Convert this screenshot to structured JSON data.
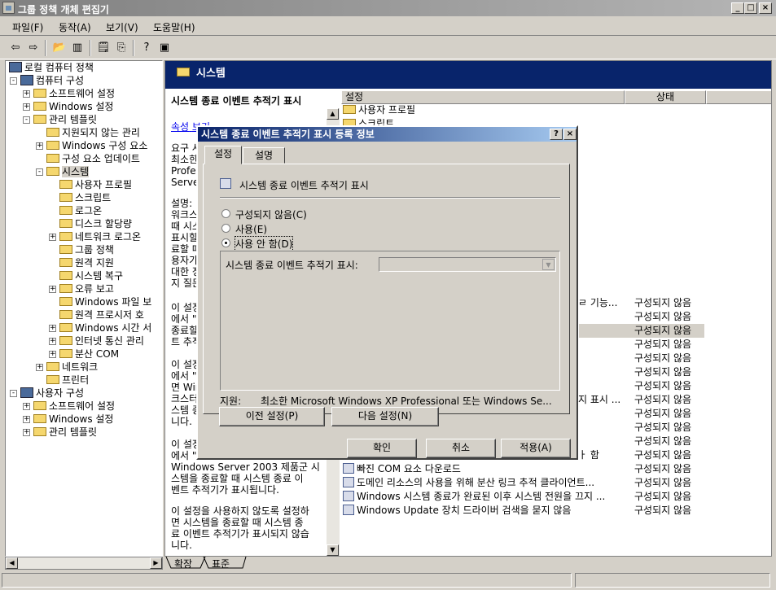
{
  "window": {
    "title": "그룹 정책 개체 편집기",
    "min": "_",
    "max": "□",
    "close": "×"
  },
  "menu": [
    "파일(F)",
    "동작(A)",
    "보기(V)",
    "도움말(H)"
  ],
  "toolbar_icons": [
    "back-arrow-icon",
    "forward-arrow-icon",
    "up-folder-icon",
    "show-tree-icon",
    "properties-icon",
    "export-icon",
    "help-icon",
    "console-icon"
  ],
  "tree": {
    "root": "로컬 컴퓨터 정책",
    "items": [
      {
        "label": "컴퓨터 구성",
        "level": 1,
        "exp": "-"
      },
      {
        "label": "소프트웨어 설정",
        "level": 2,
        "exp": "+"
      },
      {
        "label": "Windows 설정",
        "level": 2,
        "exp": "+"
      },
      {
        "label": "관리 템플릿",
        "level": 2,
        "exp": "-"
      },
      {
        "label": "지원되지 않는 관리",
        "level": 3,
        "exp": ""
      },
      {
        "label": "Windows 구성 요소",
        "level": 3,
        "exp": "+"
      },
      {
        "label": "구성 요소 업데이트",
        "level": 3,
        "exp": ""
      },
      {
        "label": "시스템",
        "level": 3,
        "exp": "-"
      },
      {
        "label": "사용자 프로필",
        "level": 4,
        "exp": ""
      },
      {
        "label": "스크립트",
        "level": 4,
        "exp": ""
      },
      {
        "label": "로그온",
        "level": 4,
        "exp": ""
      },
      {
        "label": "디스크 할당량",
        "level": 4,
        "exp": ""
      },
      {
        "label": "네트워크 로그온",
        "level": 4,
        "exp": "+"
      },
      {
        "label": "그룹 정책",
        "level": 4,
        "exp": ""
      },
      {
        "label": "원격 지원",
        "level": 4,
        "exp": ""
      },
      {
        "label": "시스템 복구",
        "level": 4,
        "exp": ""
      },
      {
        "label": "오류 보고",
        "level": 4,
        "exp": "+"
      },
      {
        "label": "Windows 파일 보",
        "level": 4,
        "exp": ""
      },
      {
        "label": "원격 프로시저 호",
        "level": 4,
        "exp": ""
      },
      {
        "label": "Windows 시간 서",
        "level": 4,
        "exp": "+"
      },
      {
        "label": "인터넷 통신 관리",
        "level": 4,
        "exp": "+"
      },
      {
        "label": "분산 COM",
        "level": 4,
        "exp": "+"
      },
      {
        "label": "네트워크",
        "level": 3,
        "exp": "+"
      },
      {
        "label": "프린터",
        "level": 3,
        "exp": ""
      },
      {
        "label": "사용자 구성",
        "level": 1,
        "exp": "-"
      },
      {
        "label": "소프트웨어 설정",
        "level": 2,
        "exp": "+"
      },
      {
        "label": "Windows 설정",
        "level": 2,
        "exp": "+"
      },
      {
        "label": "관리 템플릿",
        "level": 2,
        "exp": "+"
      }
    ]
  },
  "right": {
    "header": "시스템",
    "desc_title": "시스템 종료 이벤트 추적기 표시",
    "desc_link": "속성",
    "desc_link_after": "보기",
    "desc_blocks": [
      [
        "요구 사",
        "최소한",
        "Profes",
        "Serve"
      ],
      [
        "설명:",
        "워크스",
        "때 시스",
        "표시할",
        "료할 때",
        "용자가",
        "대한 정",
        "지 질문"
      ],
      [
        "이 설정",
        "에서 \"",
        "종료할",
        "트 추적"
      ],
      [
        "이 설정",
        "에서 \"",
        "면 Win",
        "크스터",
        "스템 종",
        "니다."
      ],
      [
        "이 설정",
        "에서 \"",
        "Windows Server 2003 제품군 시",
        "스템을 종료할 때 시스템 종료 이",
        "벤트 추적기가 표시됩니다."
      ],
      [
        "이 설정을 사용하지 않도록 설정하",
        "면 시스템을 종료할 때 시스템 종",
        "료 이벤트 추적기가 표시되지 않습",
        "니다."
      ]
    ],
    "col_setting": "설정",
    "col_status": "상태",
    "top_rows": [
      "사용자 프로필",
      "스크립트"
    ],
    "rows": [
      {
        "name": "",
        "tail": "ㄹ 기능...",
        "status": "구성되지 않음"
      },
      {
        "name": "",
        "tail": "",
        "status": "구성되지 않음"
      },
      {
        "name": "",
        "tail": "",
        "status": "구성되지 않음"
      },
      {
        "name": "",
        "tail": "",
        "status": "구성되지 않음"
      },
      {
        "name": "",
        "tail": "",
        "status": "구성되지 않음"
      },
      {
        "name": "",
        "tail": "",
        "status": "구성되지 않음"
      },
      {
        "name": "",
        "tail": "",
        "status": "구성되지 않음"
      },
      {
        "name": "",
        "tail": "지 표시 ...",
        "status": "구성되지 않음"
      },
      {
        "name": "",
        "tail": "",
        "status": "구성되지 않음"
      },
      {
        "name": "",
        "tail": "",
        "status": "구성되지 않음"
      },
      {
        "name": "",
        "tail": "",
        "status": "구성되지 않음"
      },
      {
        "name": "",
        "tail": "ㅏ 함",
        "status": "구성되지 않음"
      },
      {
        "name": "빠진 COM 요소 다운로드",
        "tail": "",
        "status": "구성되지 않음"
      },
      {
        "name": "도메인 리소스의 사용을 위해 분산 링크 추적 클라이언트...",
        "tail": "",
        "status": "구성되지 않음"
      },
      {
        "name": "Windows 시스템 종료가 완료된 이후 시스템 전원을 끄지 ...",
        "tail": "",
        "status": "구성되지 않음"
      },
      {
        "name": "Windows Update 장치 드라이버 검색을 묻지 않음",
        "tail": "",
        "status": "구성되지 않음"
      }
    ],
    "tab_extended": "확장",
    "tab_standard": "표준"
  },
  "dialog": {
    "title": "시스템 종료 이벤트 추적기 표시 등록 정보",
    "help": "?",
    "close": "×",
    "tabs": [
      "설정",
      "설명"
    ],
    "policy_name": "시스템 종료 이벤트 추적기 표시",
    "radios": [
      "구성되지 않음(C)",
      "사용(E)",
      "사용 안 함(D)"
    ],
    "selected_radio": 2,
    "combo_label": "시스템 종료 이벤트 추적기 표시:",
    "support_label": "지원:",
    "support_text": "최소한 Microsoft Windows XP Professional 또는 Windows Se...",
    "prev": "이전 설정(P)",
    "next": "다음 설정(N)",
    "ok": "확인",
    "cancel": "취소",
    "apply": "적용(A)"
  }
}
